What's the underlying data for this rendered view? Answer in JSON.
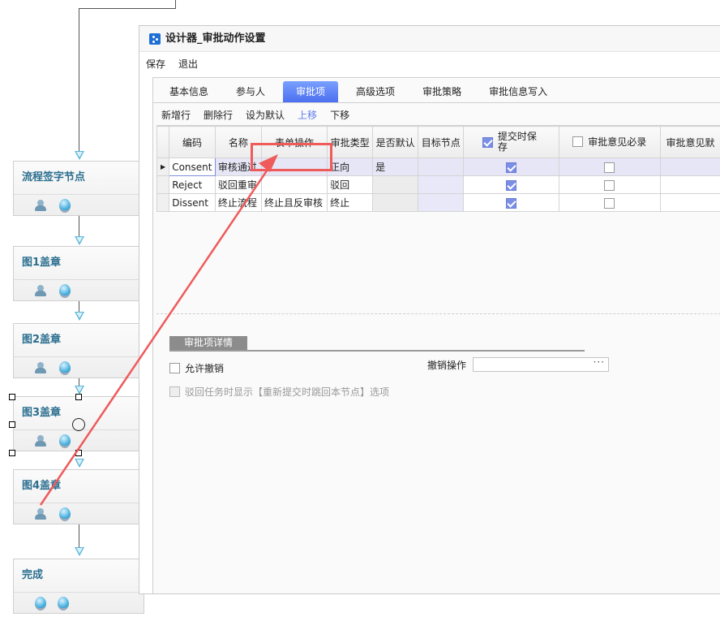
{
  "flow": {
    "nodes": [
      {
        "title": "流程签字节点",
        "icons": [
          "user",
          "globe"
        ]
      },
      {
        "title": "图1盖章",
        "icons": [
          "user",
          "globe"
        ]
      },
      {
        "title": "图2盖章",
        "icons": [
          "user",
          "globe"
        ]
      },
      {
        "title": "图3盖章",
        "icons": [
          "user",
          "globe"
        ]
      },
      {
        "title": "图4盖章",
        "icons": [
          "user",
          "globe"
        ]
      },
      {
        "title": "完成",
        "icons": [
          "globe",
          "globe"
        ]
      }
    ]
  },
  "dialog": {
    "title": "设计器_审批动作设置",
    "menu": [
      "保存",
      "退出"
    ],
    "tabs": [
      "基本信息",
      "参与人",
      "审批项",
      "高级选项",
      "审批策略",
      "审批信息写入"
    ],
    "active_tab": "审批项",
    "toolbar": [
      "新增行",
      "删除行",
      "设为默认",
      "上移",
      "下移"
    ],
    "toolbar_highlight": "上移",
    "grid": {
      "columns": [
        "编码",
        "名称",
        "表单操作",
        "审批类型",
        "是否默认",
        "目标节点",
        "提交时保存",
        "审批意见必录",
        "审批意见默"
      ],
      "rows": [
        {
          "code": "Consent",
          "name": "审核通过",
          "form_op": "",
          "type": "正向",
          "default": "是",
          "target": "",
          "save": true,
          "required": false,
          "selected": true
        },
        {
          "code": "Reject",
          "name": "驳回重审",
          "form_op": "",
          "type": "驳回",
          "default": "",
          "target": "",
          "save": true,
          "required": false,
          "selected": false
        },
        {
          "code": "Dissent",
          "name": "终止流程",
          "form_op": "终止且反审核",
          "type": "终止",
          "default": "",
          "target": "",
          "save": true,
          "required": false,
          "selected": false
        }
      ]
    },
    "detail": {
      "tab_label": "审批项详情",
      "allow_cancel_label": "允许撤销",
      "cancel_op_label": "撤销操作",
      "cancel_op_value": "",
      "cancel_op_ellipsis": "···",
      "reject_option_label": "驳回任务时显示【重新提交时跳回本节点】选项"
    }
  },
  "colors": {
    "active_tab": "#4b6ff0",
    "annotation": "#ef5a5a",
    "node_title": "#2c6f8f",
    "checkbox_on": "#7b8ee6"
  }
}
